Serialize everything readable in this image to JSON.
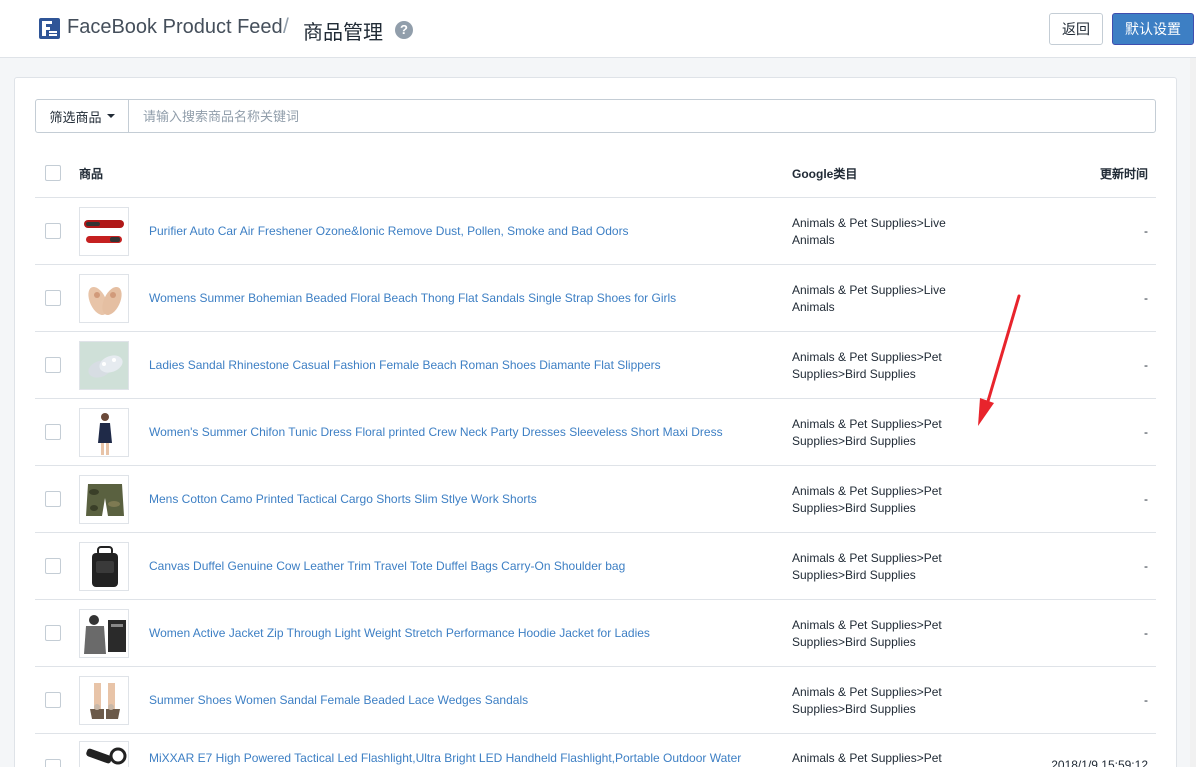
{
  "header": {
    "app_title": "FaceBook Product Feed",
    "separator": "/",
    "page_title": "商品管理",
    "help": "?",
    "back_label": "返回",
    "default_settings_label": "默认设置"
  },
  "filter": {
    "label": "筛选商品",
    "search_placeholder": "请输入搜索商品名称关键词"
  },
  "table": {
    "headers": {
      "product": "商品",
      "category": "Google类目",
      "updated": "更新时间"
    },
    "rows": [
      {
        "name": "Purifier Auto Car Air Freshener Ozone&Ionic Remove Dust, Pollen, Smoke and Bad Odors",
        "category": "Animals & Pet Supplies>Live Animals",
        "updated": "-"
      },
      {
        "name": "Womens Summer Bohemian Beaded Floral Beach Thong Flat Sandals Single Strap Shoes for Girls",
        "category": "Animals & Pet Supplies>Live Animals",
        "updated": "-"
      },
      {
        "name": "Ladies Sandal Rhinestone Casual Fashion Female Beach Roman Shoes Diamante Flat Slippers",
        "category": "Animals & Pet Supplies>Pet Supplies>Bird Supplies",
        "updated": "-"
      },
      {
        "name": "Women's Summer Chifon Tunic Dress Floral printed Crew Neck Party Dresses Sleeveless Short Maxi Dress",
        "category": "Animals & Pet Supplies>Pet Supplies>Bird Supplies",
        "updated": "-"
      },
      {
        "name": "Mens Cotton Camo Printed Tactical Cargo Shorts Slim Stlye Work Shorts",
        "category": "Animals & Pet Supplies>Pet Supplies>Bird Supplies",
        "updated": "-"
      },
      {
        "name": "Canvas Duffel Genuine Cow Leather Trim Travel Tote Duffel Bags Carry-On Shoulder bag",
        "category": "Animals & Pet Supplies>Pet Supplies>Bird Supplies",
        "updated": "-"
      },
      {
        "name": "Women Active Jacket Zip Through Light Weight Stretch Performance Hoodie Jacket for Ladies",
        "category": "Animals & Pet Supplies>Pet Supplies>Bird Supplies",
        "updated": "-"
      },
      {
        "name": "Summer Shoes Women Sandal Female Beaded Lace Wedges Sandals",
        "category": "Animals & Pet Supplies>Pet Supplies>Bird Supplies",
        "updated": "-"
      },
      {
        "name": "MiXXAR E7 High Powered Tactical Led Flashlight,Ultra Bright LED Handheld Flashlight,Portable Outdoor Water",
        "category": "Animals & Pet Supplies>Pet",
        "updated": "2018/1/9 15:59:12"
      }
    ]
  },
  "colors": {
    "accent": "#3d7fc4",
    "annotation_arrow": "#e8242c"
  }
}
